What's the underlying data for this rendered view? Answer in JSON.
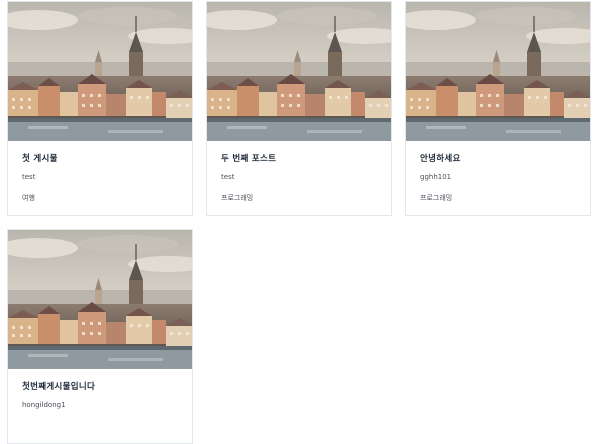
{
  "posts": [
    {
      "title": "첫 게시물",
      "author": "test",
      "category": "여행"
    },
    {
      "title": "두 번째 포스트",
      "author": "test",
      "category": "프로그래밍"
    },
    {
      "title": "안녕하세요",
      "author": "gghh101",
      "category": "프로그래밍"
    },
    {
      "title": "첫번째게시물입니다",
      "author": "hongildong1",
      "category": ""
    }
  ],
  "thumbnail": {
    "icon": "city-photo-thumbnail"
  },
  "colors": {
    "card_border": "#e3e6ea",
    "title": "#1e2a3a",
    "meta": "#4a4f57",
    "sky": "#d6d0c6"
  }
}
